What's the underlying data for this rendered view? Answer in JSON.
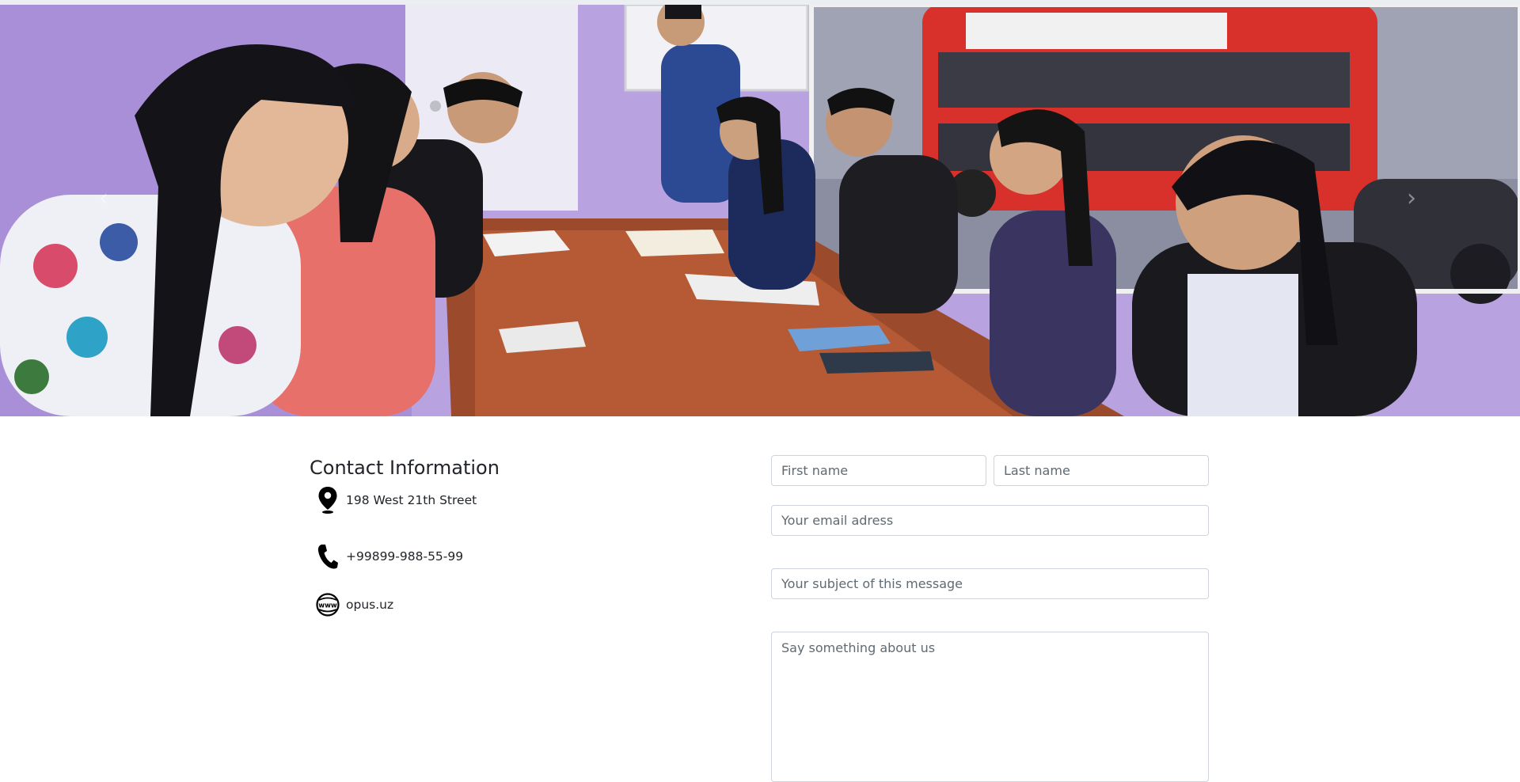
{
  "hero": {
    "carousel_prev_glyph": "‹",
    "carousel_next_glyph": "›",
    "icons": {
      "prev": "chevron-left-icon",
      "next": "chevron-right-icon"
    }
  },
  "contact": {
    "title": "Contact Information",
    "items": [
      {
        "icon": "map-pin-icon",
        "text": "198 West 21th Street"
      },
      {
        "icon": "phone-icon",
        "text": "+99899-988-55-99"
      },
      {
        "icon": "globe-www-icon",
        "text": "opus.uz"
      }
    ]
  },
  "form": {
    "first_name_placeholder": "First name",
    "last_name_placeholder": "Last name",
    "email_placeholder": "Your email adress",
    "subject_placeholder": "Your subject of this message",
    "message_placeholder": "Say something about us"
  },
  "colors": {
    "input_border": "#ced4da",
    "text": "#212529",
    "placeholder": "#5f6a72"
  }
}
